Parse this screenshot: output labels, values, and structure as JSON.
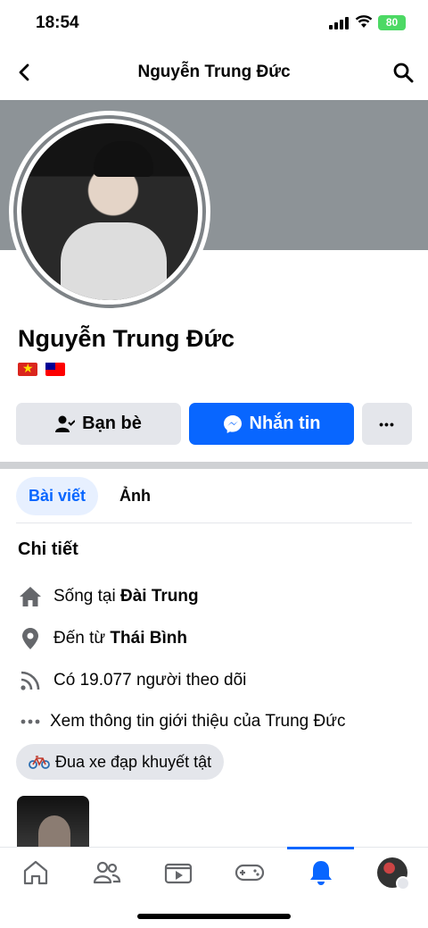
{
  "status_bar": {
    "time": "18:54",
    "battery": "80"
  },
  "nav": {
    "title": "Nguyễn Trung Đức"
  },
  "profile": {
    "name": "Nguyễn Trung Đức"
  },
  "actions": {
    "friends_label": "Bạn bè",
    "message_label": "Nhắn tin",
    "more_label": "•••"
  },
  "tabs": [
    {
      "label": "Bài viết"
    },
    {
      "label": "Ảnh"
    }
  ],
  "details": {
    "title": "Chi tiết",
    "lives_prefix": "Sống tại ",
    "lives_place": "Đài Trung",
    "from_prefix": "Đến từ ",
    "from_place": "Thái Bình",
    "followers": "Có 19.077 người theo dõi",
    "see_intro": "Xem thông tin giới thiệu của Trung Đức",
    "hobby": "Đua xe đạp khuyết tật"
  },
  "colors": {
    "accent": "#0866ff",
    "cover": "#8d9397",
    "button_gray": "#e4e6eb"
  }
}
